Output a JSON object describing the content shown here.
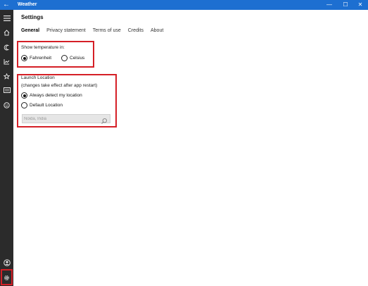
{
  "window": {
    "title": "Weather",
    "back_glyph": "←",
    "minimize_glyph": "—",
    "maximize_glyph": "☐",
    "close_glyph": "✕",
    "title_bar_color": "#1d6fd1"
  },
  "sidebar": {
    "background": "#2b2b2b",
    "items": [
      {
        "name": "hamburger-menu-icon"
      },
      {
        "name": "home-icon"
      },
      {
        "name": "maps-icon"
      },
      {
        "name": "historical-weather-icon"
      },
      {
        "name": "favorites-icon"
      },
      {
        "name": "news-icon"
      },
      {
        "name": "life-icon"
      },
      {
        "name": "account-icon"
      },
      {
        "name": "settings-icon",
        "highlighted": true
      }
    ]
  },
  "page": {
    "title": "Settings",
    "tabs": [
      {
        "label": "General",
        "active": true
      },
      {
        "label": "Privacy statement"
      },
      {
        "label": "Terms of use"
      },
      {
        "label": "Credits"
      },
      {
        "label": "About"
      }
    ]
  },
  "temperature": {
    "heading": "Show temperature in:",
    "options": [
      {
        "label": "Fahrenheit",
        "selected": true
      },
      {
        "label": "Celsius",
        "selected": false
      }
    ]
  },
  "launch": {
    "heading": "Launch Location",
    "note": "(changes take effect after app restart)",
    "options": [
      {
        "label": "Always detect my location",
        "selected": true
      },
      {
        "label": "Default Location",
        "selected": false
      }
    ],
    "location_placeholder": "Noida, India"
  },
  "highlight_color": "#d51f26"
}
